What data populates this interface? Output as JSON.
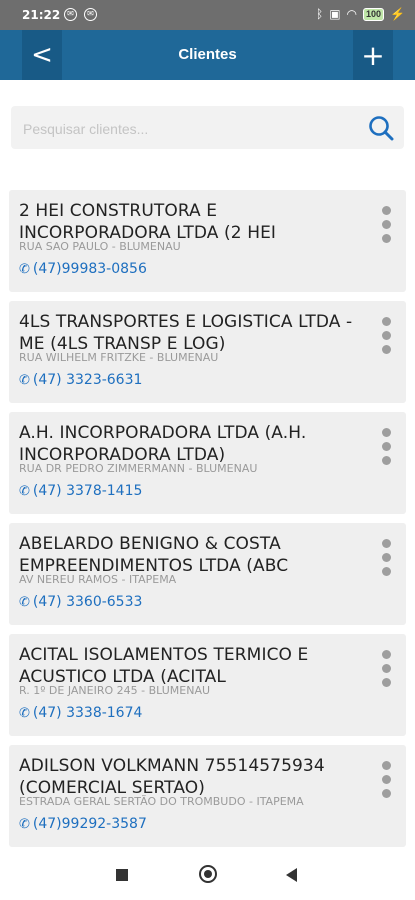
{
  "status_bar": {
    "time": "21:22",
    "battery": "100"
  },
  "app_bar": {
    "title": "Clientes",
    "back_label": "<",
    "add_label": "+"
  },
  "search": {
    "placeholder": "Pesquisar clientes..."
  },
  "colors": {
    "app_bar": "#1f6898",
    "link": "#1e6fbf",
    "card_bg": "#efefef"
  },
  "clients": [
    {
      "name": "2 HEI CONSTRUTORA E INCORPORADORA LTDA (2 HEI",
      "address": "RUA SAO PAULO - BLUMENAU",
      "phone": "(47)99983-0856"
    },
    {
      "name": "4LS TRANSPORTES E LOGISTICA LTDA - ME (4LS TRANSP E LOG)",
      "address": "RUA WILHELM FRITZKE - BLUMENAU",
      "phone": "(47) 3323-6631"
    },
    {
      "name": "A.H. INCORPORADORA LTDA (A.H. INCORPORADORA LTDA)",
      "address": "RUA DR PEDRO ZIMMERMANN - BLUMENAU",
      "phone": "(47) 3378-1415"
    },
    {
      "name": "ABELARDO BENIGNO & COSTA EMPREENDIMENTOS LTDA (ABC",
      "address": "AV NEREU RAMOS - ITAPEMA",
      "phone": "(47) 3360-6533"
    },
    {
      "name": "ACITAL ISOLAMENTOS TERMICO E ACUSTICO LTDA (ACITAL",
      "address": "R. 1º DE JANEIRO 245 - BLUMENAU",
      "phone": "(47) 3338-1674"
    },
    {
      "name": "ADILSON VOLKMANN 75514575934 (COMERCIAL SERTAO)",
      "address": "ESTRADA GERAL SERTÃO DO TROMBUDO - ITAPEMA",
      "phone": "(47)99292-3587"
    }
  ]
}
